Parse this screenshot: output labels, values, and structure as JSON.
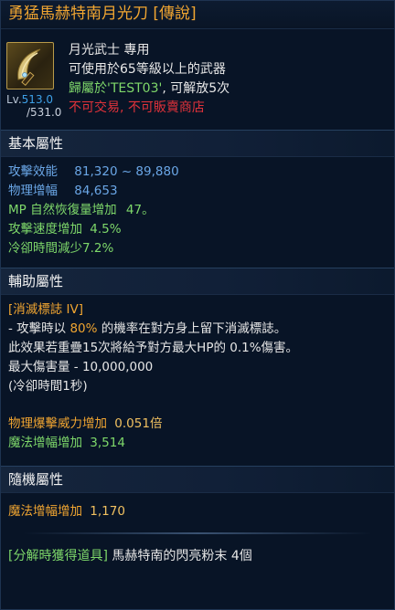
{
  "title": "勇猛馬赫特南月光刀 [傳說]",
  "item": {
    "icon": "crescent-blade-icon",
    "level_prefix": "Lv.",
    "level_current": "513.0",
    "level_max": "/531.0",
    "class_restriction": "月光武士 專用",
    "level_requirement": "可使用於65等級以上的武器",
    "owner_prefix": "歸屬於",
    "owner_name": "'TEST03'",
    "owner_suffix": ", 可解放5次",
    "trade_restriction": "不可交易, 不可販賣商店"
  },
  "basic": {
    "header": "基本屬性",
    "stats": [
      {
        "label": "攻擊效能",
        "value": "81,320 ~ 89,880"
      },
      {
        "label": "物理增幅",
        "value": "84,653"
      },
      {
        "label": "MP 自然恢復量增加",
        "value": "47。"
      },
      {
        "label": "攻擊速度增加",
        "value": "4.5%"
      },
      {
        "label": "冷卻時間減少",
        "value": "7.2%"
      }
    ]
  },
  "auxiliary": {
    "header": "輔助屬性",
    "effect_name": "[消滅標誌 IV]",
    "line1_a": "- 攻擊時以 ",
    "line1_hl": "80%",
    "line1_b": " 的機率在對方身上留下消滅標誌。",
    "line2": "此效果若重疊15次將給予對方最大HP的 0.1%傷害。",
    "line3": "最大傷害量 - 10,000,000",
    "line4": "(冷卻時間1秒)",
    "stats": [
      {
        "label": "物理爆擊威力增加",
        "value": "0.051倍"
      },
      {
        "label": "魔法增幅增加",
        "value": "3,514"
      }
    ]
  },
  "random": {
    "header": "隨機屬性",
    "stats": [
      {
        "label": "魔法增幅增加",
        "value": "1,170"
      }
    ]
  },
  "disassemble": {
    "label": "[分解時獲得道具]",
    "item": "馬赫特南的閃亮粉末 4個"
  },
  "colors": {
    "title": "#f0a531",
    "stat_blue": "#6aa6e6",
    "stat_green": "#7ed86a",
    "warning_red": "#e0323a",
    "background": "#081426"
  }
}
